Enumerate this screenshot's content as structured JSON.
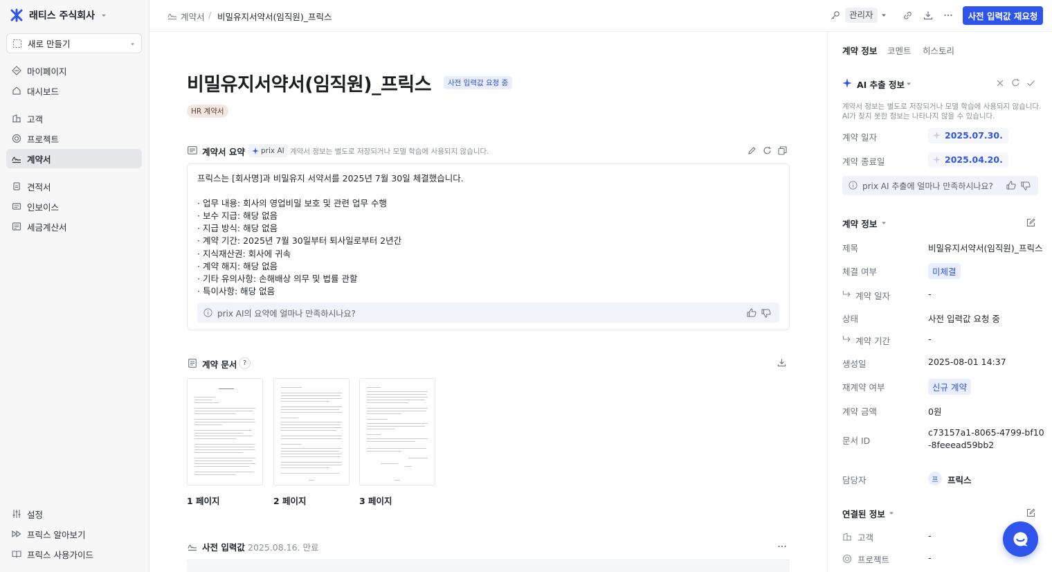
{
  "sidebar": {
    "company": "래티스 주식회사",
    "new_button": "새로 만들기",
    "items": [
      {
        "label": "마이페이지",
        "icon": "diamond-icon"
      },
      {
        "label": "대시보드",
        "icon": "home-icon"
      },
      {
        "label": "고객",
        "icon": "building-icon"
      },
      {
        "label": "프로젝트",
        "icon": "target-icon"
      },
      {
        "label": "계약서",
        "icon": "signature-icon"
      },
      {
        "label": "견적서",
        "icon": "copy-doc-icon"
      },
      {
        "label": "인보이스",
        "icon": "invoice-icon"
      },
      {
        "label": "세금계산서",
        "icon": "tax-doc-icon"
      }
    ],
    "bottom_items": [
      {
        "label": "설정",
        "icon": "sliders-icon"
      },
      {
        "label": "프릭스 알아보기",
        "icon": "forward-icon"
      },
      {
        "label": "프릭스 사용가이드",
        "icon": "book-icon"
      }
    ]
  },
  "topbar": {
    "breadcrumb_parent": "계약서",
    "breadcrumb_sep": "/",
    "breadcrumb_current": "비밀유지서약서(임직원)_프릭스",
    "role": "관리자",
    "primary_button": "사전 입력값 재요청"
  },
  "main": {
    "title": "비밀유지서약서(임직원)_프릭스",
    "status_badge": "사전 입력값 요청 중",
    "tag": "HR 계약서",
    "summary": {
      "heading": "계약서 요약",
      "ai_badge": "prix AI",
      "disclaimer": "계약서 정보는 별도로 저장되거나 모델 학습에 사용되지 않습니다.",
      "lines": [
        "프릭스는 [회사명]과 비밀유지 서약서를 2025년 7월 30일 체결했습니다.",
        "· 업무 내용: 회사의 영업비밀 보호 및 관련 업무 수행",
        "· 보수 지급: 해당 없음",
        "· 지급 방식: 해당 없음",
        "· 계약 기간: 2025년 7월 30일부터 퇴사일로부터 2년간",
        "· 지식재산권: 회사에 귀속",
        "· 계약 해지: 해당 없음",
        "· 기타 유의사항: 손해배상 의무 및 법률 관할",
        "· 특이사항: 해당 없음"
      ],
      "feedback": "prix AI의 요약에 얼마나 만족하시나요?"
    },
    "documents": {
      "heading": "계약 문서",
      "help": "?",
      "pages": [
        "1 페이지",
        "2 페이지",
        "3 페이지"
      ]
    },
    "preinput": {
      "heading": "사전 입력값",
      "meta": "2025.08.16. 만료"
    }
  },
  "right": {
    "tabs": [
      "계약 정보",
      "코멘트",
      "히스토리"
    ],
    "ai_section": {
      "title": "AI 추출 정보",
      "note1": "계약서 정보는 별도로 저장되거나 모델 학습에 사용되지 않습니다.",
      "note2": "AI가 찾지 못한 정보는 나타나지 않을 수 있습니다.",
      "fields": [
        {
          "label": "계약 일자",
          "value": "2025.07.30."
        },
        {
          "label": "계약 종료일",
          "value": "2025.04.20."
        }
      ],
      "feedback": "prix AI 추출에 얼마나 만족하시나요?"
    },
    "contract_info": {
      "title": "계약 정보",
      "rows": [
        {
          "label": "제목",
          "value": "비밀유지서약서(임직원)_프릭스"
        },
        {
          "label": "체결 여부",
          "value": "미체결"
        },
        {
          "label": "계약 일자",
          "value": "-"
        },
        {
          "label": "상태",
          "value": "사전 입력값 요청 중"
        },
        {
          "label": "계약 기간",
          "value": "-"
        },
        {
          "label": "생성일",
          "value": "2025-08-01 14:37"
        },
        {
          "label": "재계약 여부",
          "value": "신규 계약"
        },
        {
          "label": "계약 금액",
          "value": "0원"
        },
        {
          "label": "문서 ID",
          "value1": "c73157a1-8065-4799-bf10",
          "value2": "-8feeead59bb2"
        },
        {
          "label": "담당자",
          "avatar": "프",
          "value": "프릭스"
        }
      ]
    },
    "linked": {
      "title": "연결된 정보",
      "rows": [
        {
          "label": "고객",
          "value": "-"
        },
        {
          "label": "프로젝트",
          "value": "-"
        }
      ]
    }
  },
  "colors": {
    "accent": "#2f54eb",
    "chip_blue_bg": "#e8eefc",
    "chip_blue_text": "#2f54eb",
    "tag_bg": "#f4e6e1"
  }
}
